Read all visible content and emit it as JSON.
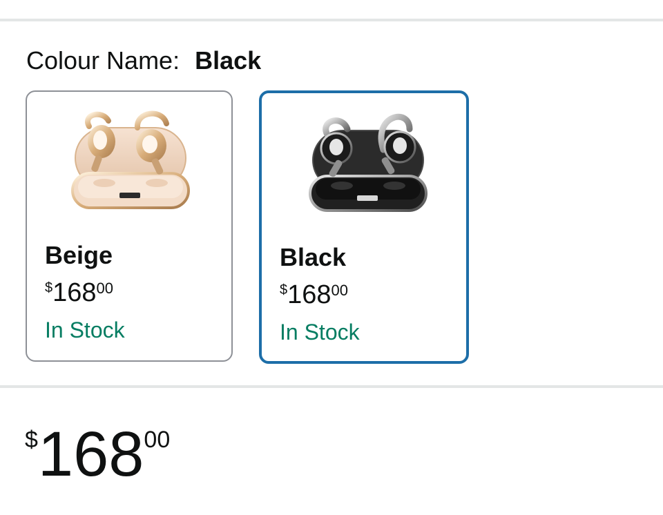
{
  "variation": {
    "label": "Colour Name:",
    "selected_value": "Black"
  },
  "swatches": [
    {
      "name": "Beige",
      "price": {
        "symbol": "$",
        "whole": "168",
        "fraction": "00"
      },
      "availability": "In Stock",
      "selected": false
    },
    {
      "name": "Black",
      "price": {
        "symbol": "$",
        "whole": "168",
        "fraction": "00"
      },
      "availability": "In Stock",
      "selected": true
    }
  ],
  "main_price": {
    "symbol": "$",
    "whole": "168",
    "fraction": "00"
  },
  "colors": {
    "selected_border": "#1d6ea8",
    "unselected_border": "#8d9096",
    "in_stock": "#067d62",
    "divider": "#e3e6e6"
  }
}
